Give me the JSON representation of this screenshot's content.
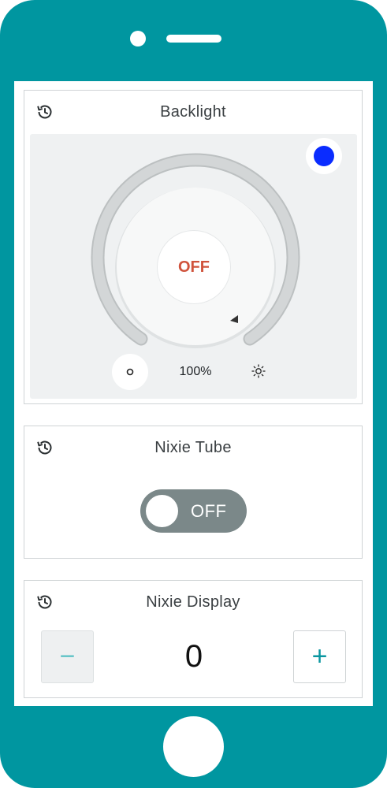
{
  "backlight": {
    "title": "Backlight",
    "state_label": "OFF",
    "brightness_label": "100%",
    "color": "#0a2cff",
    "history_icon": "history-icon",
    "dim_icon": "brightness-low-icon",
    "bright_icon": "brightness-high-icon"
  },
  "nixie_tube": {
    "title": "Nixie Tube",
    "switch_label": "OFF",
    "history_icon": "history-icon"
  },
  "nixie_display": {
    "title": "Nixie Display",
    "value": "0",
    "decrement_label": "−",
    "increment_label": "+",
    "history_icon": "history-icon"
  },
  "colors": {
    "device_frame": "#0096a0",
    "accent": "#0a96a0",
    "off_label": "#d0533c"
  }
}
